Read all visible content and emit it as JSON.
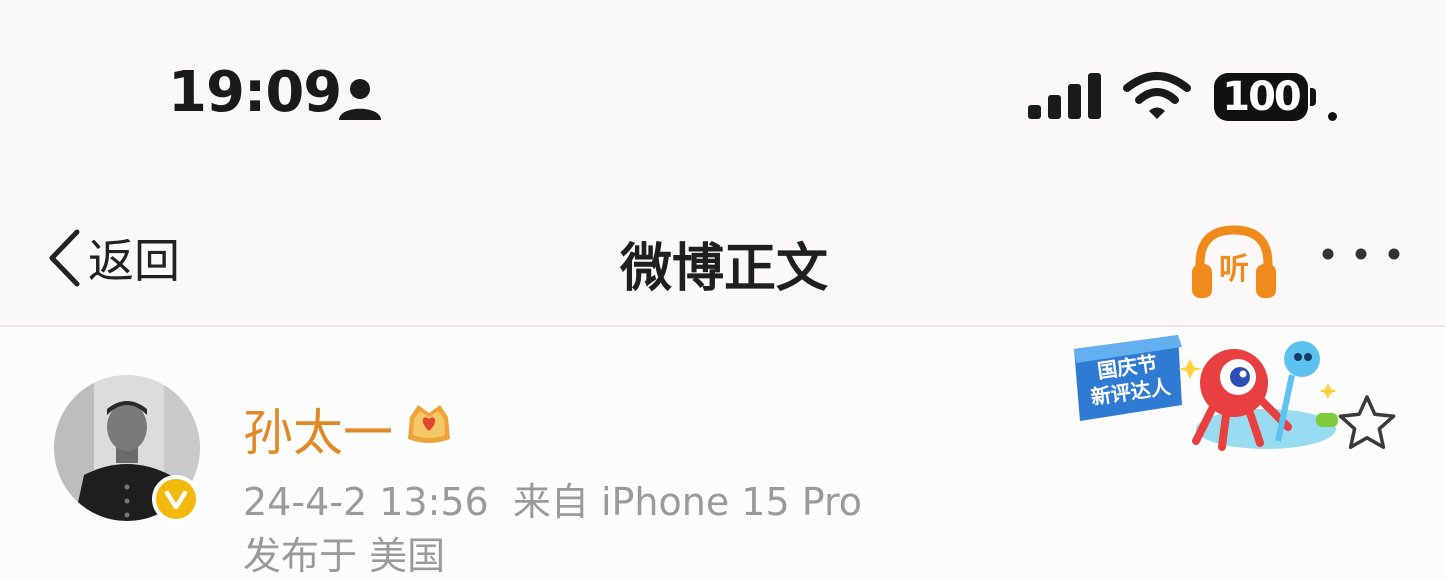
{
  "status_bar": {
    "time": "19:09",
    "battery": "100",
    "icons": [
      "person-icon",
      "signal-icon",
      "wifi-icon",
      "battery-icon"
    ]
  },
  "nav": {
    "back_label": "返回",
    "title": "微博正文",
    "listen_label": "听",
    "icons": [
      "chevron-left-icon",
      "headphones-icon",
      "more-icon"
    ]
  },
  "post": {
    "author": "孙太一",
    "meta": "24-4-2 13:56  来自 iPhone 15 Pro",
    "location": "发布于 美国",
    "event_badge_text": "国庆节 新评达人",
    "icons": [
      "avatar",
      "verified-icon",
      "vip-crown-icon",
      "star-icon"
    ]
  },
  "colors": {
    "accent": "#e08a27",
    "listen": "#f08a1b",
    "verified": "#f3b90c",
    "meta_text": "#9a9a9a"
  }
}
